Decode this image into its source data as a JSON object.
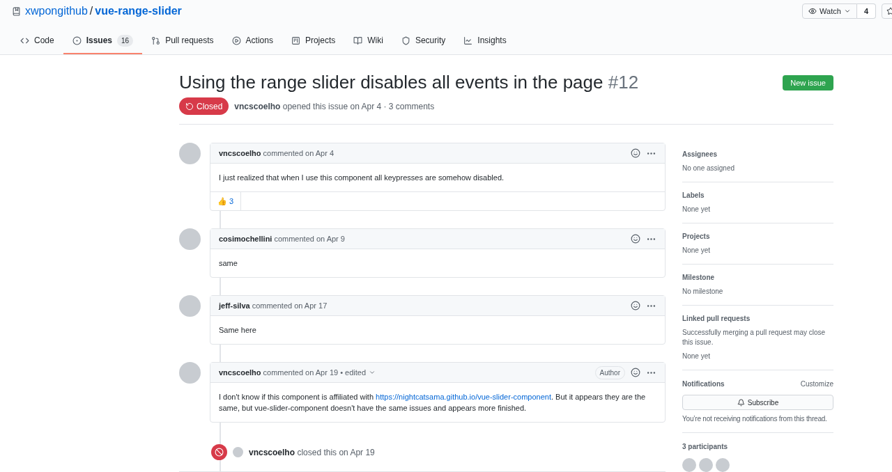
{
  "repo": {
    "owner": "xwpongithub",
    "separator": "/",
    "name": "vue-range-slider"
  },
  "watch": {
    "label": "Watch",
    "count": "4"
  },
  "tabs": [
    {
      "label": "Code",
      "selected": false
    },
    {
      "label": "Issues",
      "count": "16",
      "selected": true
    },
    {
      "label": "Pull requests",
      "selected": false
    },
    {
      "label": "Actions",
      "selected": false
    },
    {
      "label": "Projects",
      "selected": false
    },
    {
      "label": "Wiki",
      "selected": false
    },
    {
      "label": "Security",
      "selected": false
    },
    {
      "label": "Insights",
      "selected": false
    }
  ],
  "issue": {
    "title": "Using the range slider disables all events in the page",
    "number": "#12",
    "state": "Closed",
    "author": "vncscoelho",
    "meta": "opened this issue on Apr 4 · 3 comments"
  },
  "new_issue": "New issue",
  "comments": [
    {
      "author": "vncscoelho",
      "meta": "commented on Apr 4",
      "edited": false,
      "body": [
        {
          "kind": "text",
          "text": "I just realized that when I use this component all keypresses are somehow disabled."
        }
      ],
      "reactions": [
        {
          "emoji": "👍",
          "count": "3"
        }
      ]
    },
    {
      "author": "cosimochellini",
      "meta": "commented on Apr 9",
      "edited": false,
      "body": [
        {
          "kind": "text",
          "text": "same"
        }
      ]
    },
    {
      "author": "jeff-silva",
      "meta": "commented on Apr 17",
      "edited": false,
      "body": [
        {
          "kind": "text",
          "text": "Same here"
        }
      ]
    },
    {
      "author": "vncscoelho",
      "meta": "commented on Apr 19 • edited",
      "edited": true,
      "badge": "Author",
      "body": [
        {
          "kind": "text",
          "text": "I don't know if this component is affiliated with "
        },
        {
          "kind": "link",
          "text": "https://nightcatsama.github.io/vue-slider-component"
        },
        {
          "kind": "text",
          "text": ". But it appears they are the same, but vue-slider-component doesn't have the same issues and appears more finished."
        }
      ]
    }
  ],
  "event": {
    "author": "vncscoelho",
    "text": "closed this on Apr 19"
  },
  "sidebar": {
    "sections": [
      {
        "title": "Assignees",
        "lines": [
          "No one assigned"
        ]
      },
      {
        "title": "Labels",
        "lines": [
          "None yet"
        ]
      },
      {
        "title": "Projects",
        "lines": [
          "None yet"
        ]
      },
      {
        "title": "Milestone",
        "lines": [
          "No milestone"
        ]
      },
      {
        "title": "Linked pull requests",
        "lines": [
          "Successfully merging a pull request may close this issue.",
          "None yet"
        ]
      }
    ],
    "notifications": {
      "title": "Notifications",
      "customize": "Customize",
      "button": "Subscribe",
      "note": "You’re not receiving notifications from this thread."
    },
    "participants": {
      "title": "3 participants"
    }
  }
}
